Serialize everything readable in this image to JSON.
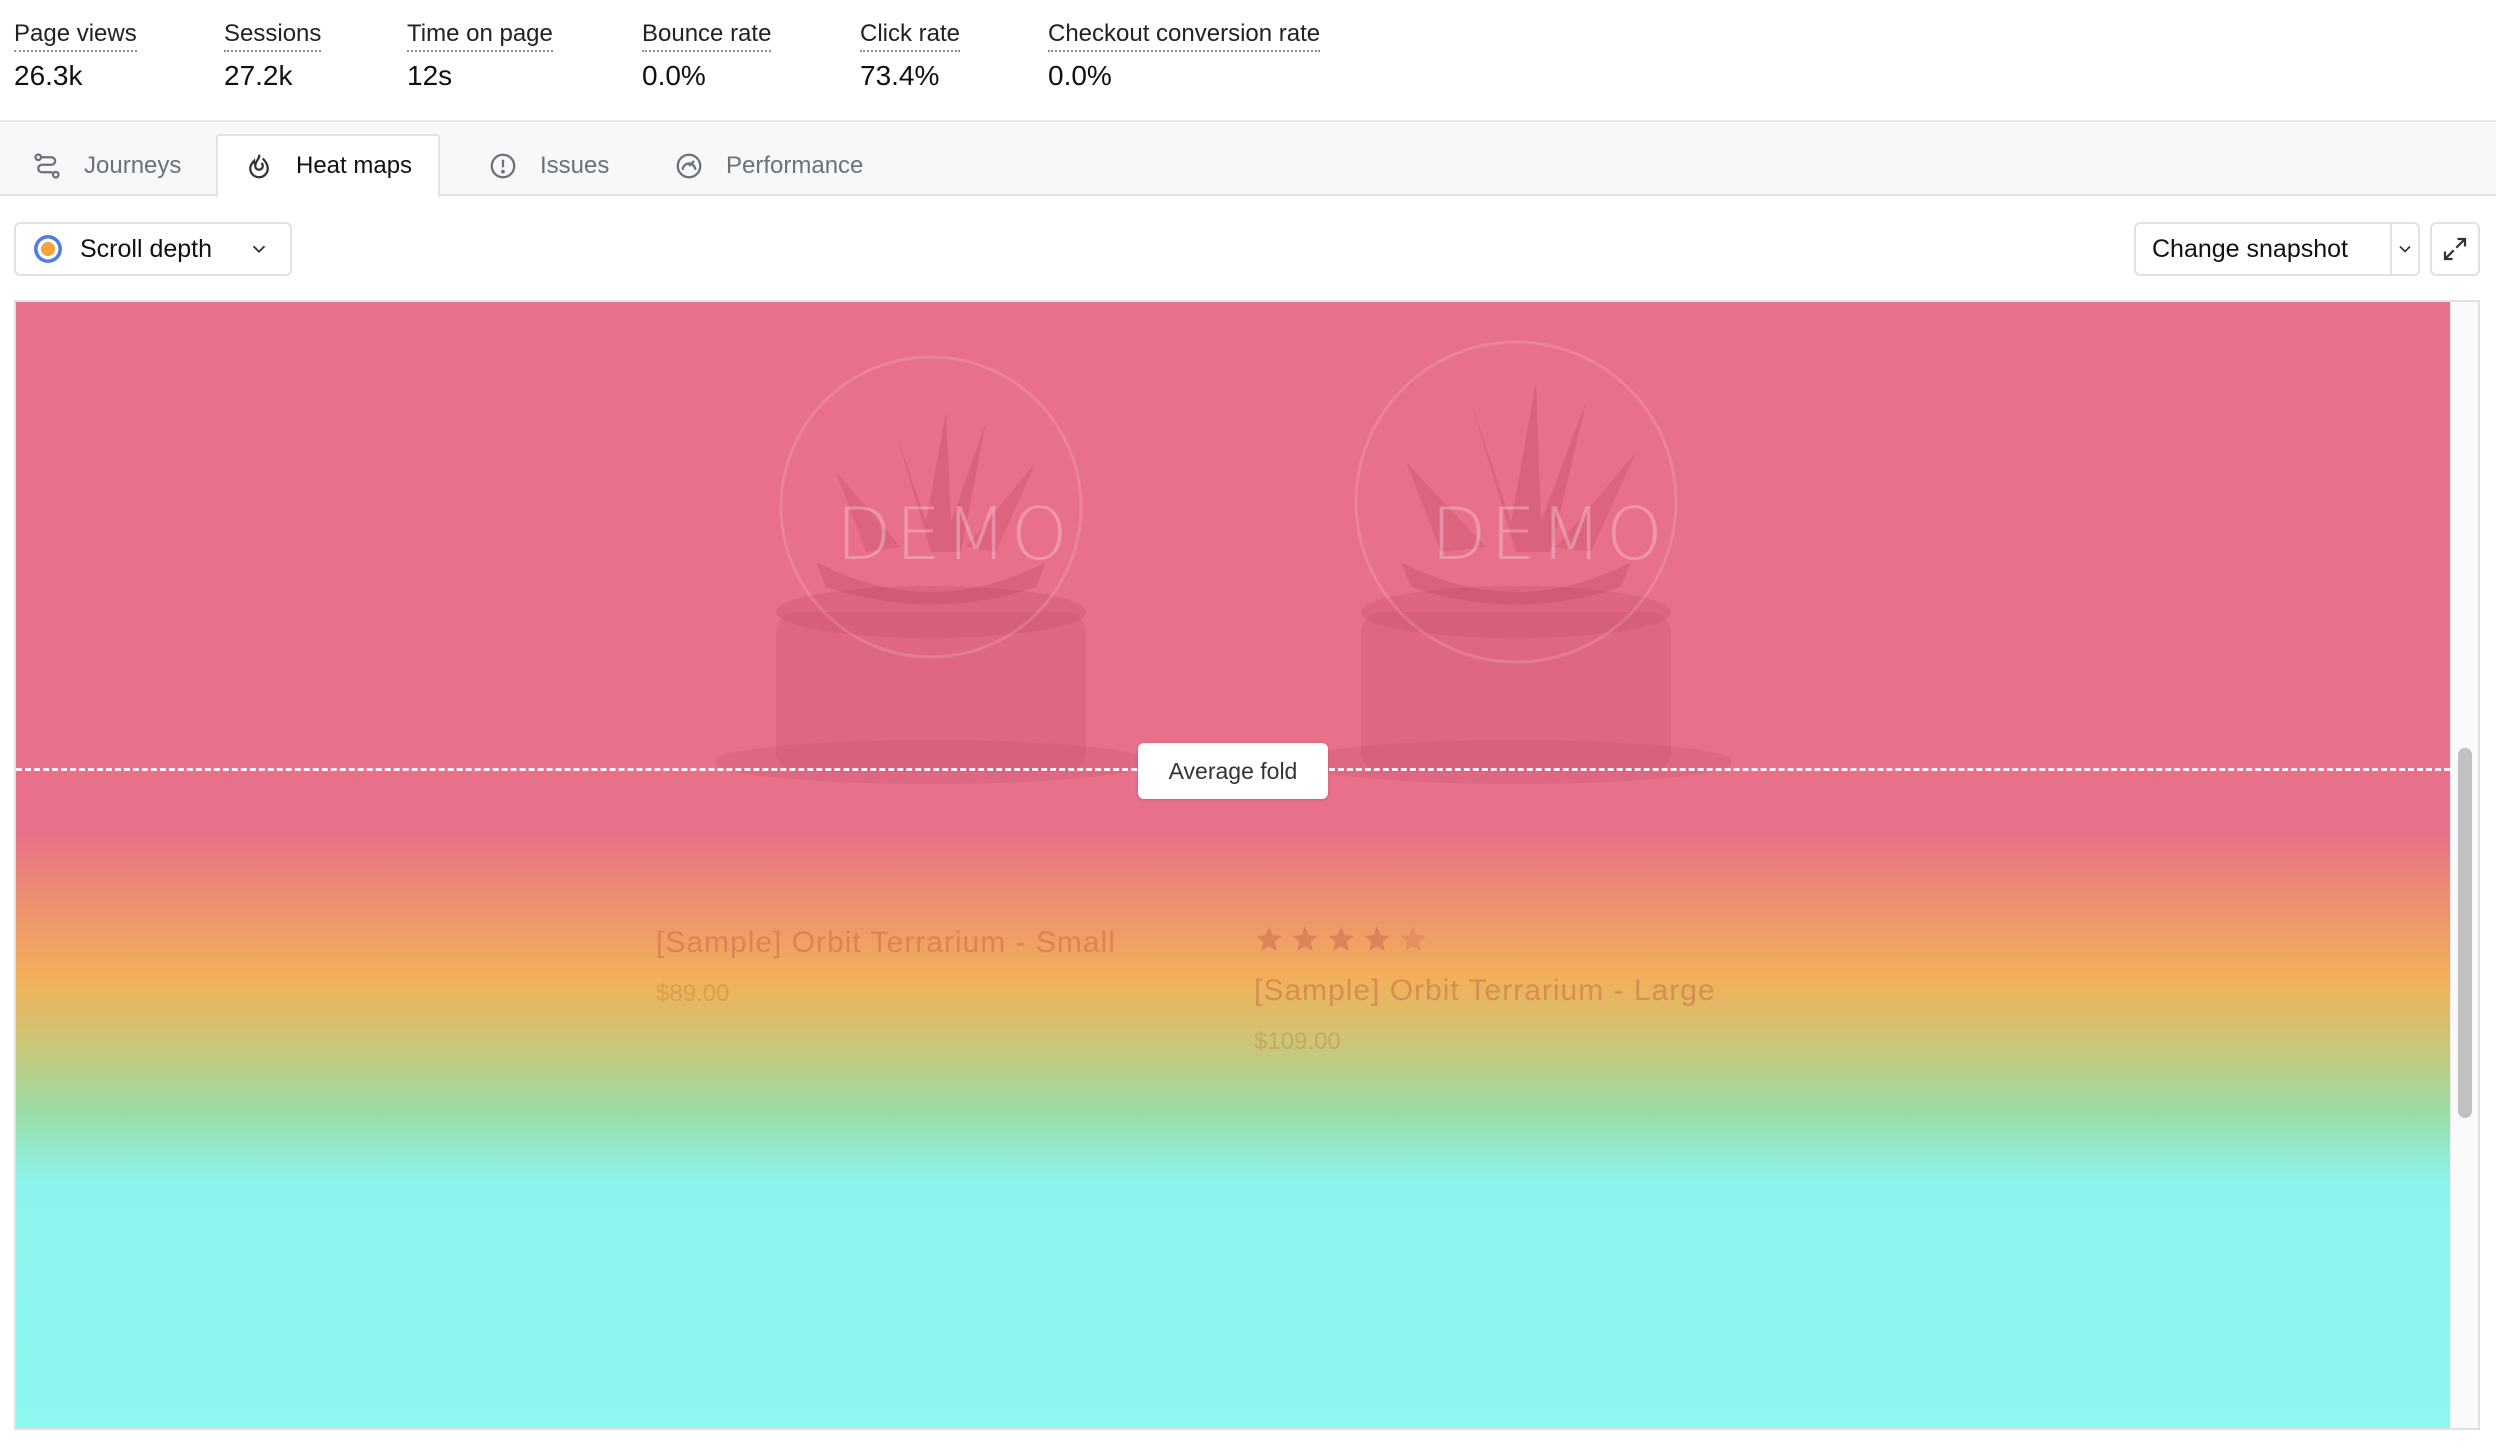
{
  "metrics": [
    {
      "label": "Page views",
      "value": "26.3k"
    },
    {
      "label": "Sessions",
      "value": "27.2k"
    },
    {
      "label": "Time on page",
      "value": "12s"
    },
    {
      "label": "Bounce rate",
      "value": "0.0%"
    },
    {
      "label": "Click rate",
      "value": "73.4%"
    },
    {
      "label": "Checkout conversion rate",
      "value": "0.0%"
    }
  ],
  "tabs": [
    {
      "label": "Journeys",
      "icon": "journeys-icon",
      "active": false
    },
    {
      "label": "Heat maps",
      "icon": "flame-icon",
      "active": true
    },
    {
      "label": "Issues",
      "icon": "alert-circle-icon",
      "active": false
    },
    {
      "label": "Performance",
      "icon": "gauge-icon",
      "active": false
    }
  ],
  "toolbar": {
    "mode_label": "Scroll depth",
    "snapshot_label": "Change snapshot"
  },
  "heatmap": {
    "fold_label": "Average fold",
    "watermark": "DEMO",
    "products": [
      {
        "title": "[Sample] Orbit Terrarium - Small",
        "price": "$89.00",
        "rating": null
      },
      {
        "title": "[Sample] Orbit Terrarium - Large",
        "price": "$109.00",
        "rating": 4
      }
    ]
  },
  "colors": {
    "hot": "#e8708a",
    "warm": "#f2b05a",
    "cold": "#8df3ee",
    "accent_blue": "#4d7ee8"
  }
}
